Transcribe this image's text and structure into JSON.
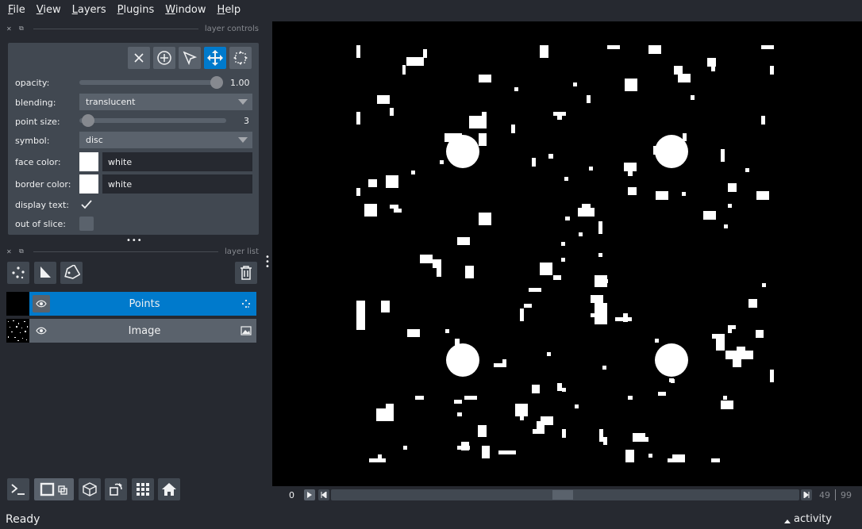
{
  "menu": [
    "File",
    "View",
    "Layers",
    "Plugins",
    "Window",
    "Help"
  ],
  "layer_controls": {
    "title": "layer controls",
    "opacity": {
      "label": "opacity:",
      "value": "1.00",
      "fraction": 1.0
    },
    "blending": {
      "label": "blending:",
      "value": "translucent"
    },
    "point_size": {
      "label": "point size:",
      "value": "3",
      "fraction": 0.05
    },
    "symbol": {
      "label": "symbol:",
      "value": "disc"
    },
    "face_color": {
      "label": "face color:",
      "value": "white",
      "swatch": "#ffffff"
    },
    "border_color": {
      "label": "border color:",
      "value": "white",
      "swatch": "#ffffff"
    },
    "display_text": {
      "label": "display text:",
      "checked": true
    },
    "out_of_slice": {
      "label": "out of slice:",
      "checked": false
    },
    "toolbar_icons": [
      "delete-points-icon",
      "add-points-icon",
      "select-points-icon",
      "pan-zoom-icon",
      "transform-icon"
    ],
    "active_tool": "pan-zoom-icon"
  },
  "layer_list": {
    "title": "layer list",
    "layers": [
      {
        "name": "Points",
        "selected": true,
        "visible": true,
        "type_icon": "points-icon"
      },
      {
        "name": "Image",
        "selected": false,
        "visible": true,
        "type_icon": "image-icon"
      }
    ]
  },
  "dims": {
    "current": "0",
    "position": "49",
    "max": "99",
    "fraction": 0.49
  },
  "status": {
    "text": "Ready",
    "activity": "activity"
  },
  "colors": {
    "accent": "#007acc",
    "background": "#262930",
    "panel": "#414851",
    "foreground": "#f0f1f2"
  }
}
